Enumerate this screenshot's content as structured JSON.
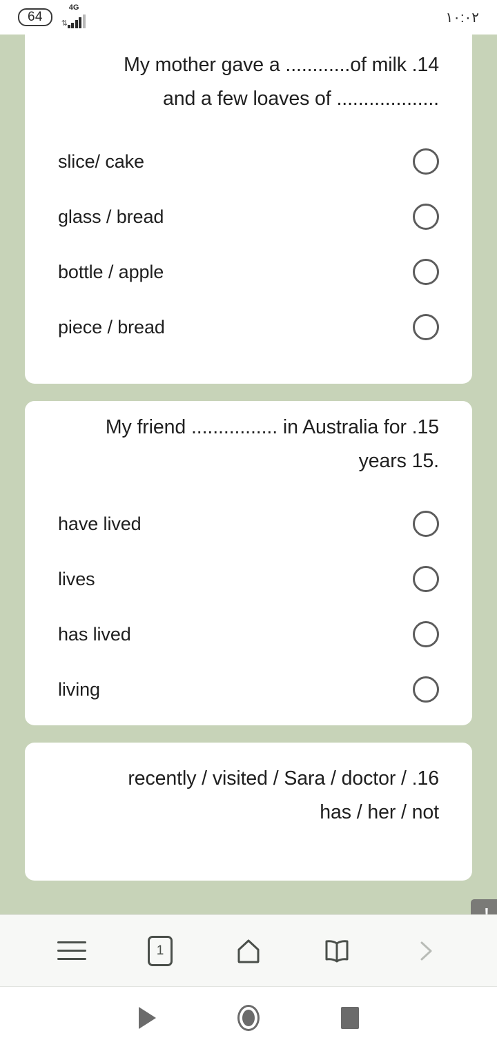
{
  "status_bar": {
    "battery_level": "64",
    "network_type": "4G",
    "data_arrows_icon": "data-transfer-icon",
    "signal_icon": "signal-bars-icon",
    "clock": "١٠:٠٢"
  },
  "theme": {
    "page_background": "#c7d3b8",
    "card_background": "#ffffff",
    "text_color": "#1f1f1f",
    "radio_border": "#5c5c5c",
    "browser_bar_background": "#f7f8f6",
    "tooltip_background": "#7a7a77"
  },
  "quiz": {
    "questions": [
      {
        "number": "14",
        "prompt_line_1": "My mother gave a ............of milk .14",
        "prompt_line_2": "................... and a few loaves of",
        "options": [
          {
            "label": "slice/ cake",
            "selected": false
          },
          {
            "label": "glass / bread",
            "selected": false
          },
          {
            "label": "bottle / apple",
            "selected": false
          },
          {
            "label": "piece / bread",
            "selected": false
          }
        ]
      },
      {
        "number": "15",
        "prompt_line_1": "My friend ................ in Australia for .15",
        "prompt_line_2": ".15 years",
        "options": [
          {
            "label": "have lived",
            "selected": false
          },
          {
            "label": "lives",
            "selected": false
          },
          {
            "label": "has lived",
            "selected": false
          },
          {
            "label": "living",
            "selected": false
          }
        ]
      },
      {
        "number": "16",
        "prompt_line_1": "recently / visited / Sara / doctor / .16",
        "prompt_line_2": "has / her / not",
        "options": []
      }
    ]
  },
  "tooltip": {
    "icon": "exclamation-icon",
    "text": "!"
  },
  "browser_bar": {
    "items": [
      {
        "name": "menu-button",
        "icon": "hamburger-menu-icon",
        "label": ""
      },
      {
        "name": "tabs-button",
        "icon": "tab-counter-icon",
        "label": "1"
      },
      {
        "name": "home-button",
        "icon": "home-icon",
        "label": ""
      },
      {
        "name": "bookmarks-button",
        "icon": "open-book-icon",
        "label": ""
      },
      {
        "name": "forward-button",
        "icon": "chevron-right-icon",
        "label": ""
      }
    ]
  },
  "system_nav": {
    "back": "back-triangle-icon",
    "home": "home-circle-icon",
    "recents": "recents-square-icon"
  }
}
